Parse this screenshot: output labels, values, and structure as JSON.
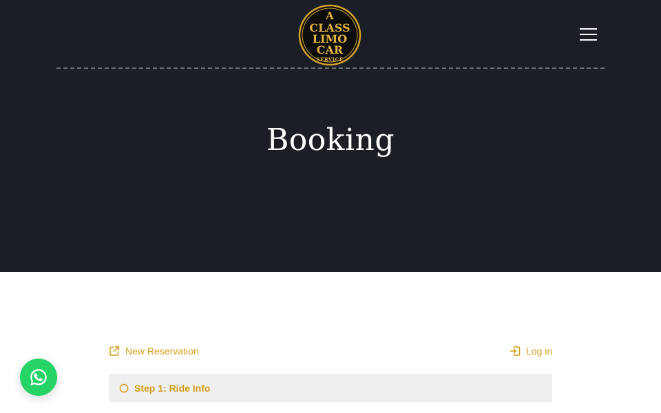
{
  "header": {
    "logo": {
      "lines": [
        "A",
        "CLASS",
        "LIMO",
        "CAR",
        "SERVICE"
      ]
    },
    "menu_icon": "hamburger-icon"
  },
  "hero": {
    "title": "Booking"
  },
  "booking": {
    "new_reservation_label": "New Reservation",
    "new_reservation_icon": "external-link-icon",
    "login_label": "Log in",
    "login_icon": "login-icon",
    "step": {
      "label": "Step 1: Ride Info",
      "icon": "circle-icon"
    }
  },
  "floating": {
    "whatsapp_icon": "whatsapp-icon"
  },
  "colors": {
    "hero_bg": "#1b1f25",
    "accent": "#d39e1a",
    "step_bg": "#efefef",
    "whatsapp": "#25d366",
    "logo_gold": "#d4a52c"
  }
}
